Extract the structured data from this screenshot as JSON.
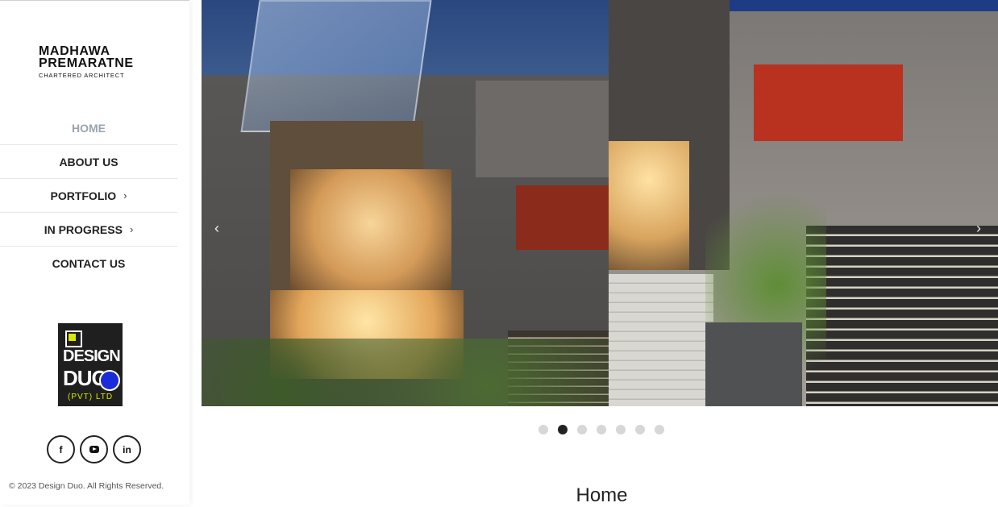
{
  "brand": {
    "line1": "MADHAWA",
    "line2": "PREMARATNE",
    "line3": "CHARTERED ARCHITECT"
  },
  "nav": {
    "items": [
      {
        "label": "HOME",
        "active": true,
        "has_chevron": false
      },
      {
        "label": "ABOUT US",
        "active": false,
        "has_chevron": false
      },
      {
        "label": "PORTFOLIO",
        "active": false,
        "has_chevron": true
      },
      {
        "label": "IN PROGRESS",
        "active": false,
        "has_chevron": true
      },
      {
        "label": "CONTACT US",
        "active": false,
        "has_chevron": false
      }
    ],
    "chevron": "›"
  },
  "badge": {
    "line1": "DESIGN",
    "line2": "DUO",
    "line3": "(PVT) LTD"
  },
  "social": {
    "facebook_label": "f",
    "linkedin_label": "in",
    "icons": [
      "facebook-icon",
      "youtube-icon",
      "linkedin-icon"
    ]
  },
  "footer": {
    "copyright": "© 2023 Design Duo. All Rights Reserved."
  },
  "slider": {
    "prev_glyph": "‹",
    "next_glyph": "›",
    "dots_total": 7,
    "active_dot_index": 1
  },
  "main": {
    "title": "Home"
  },
  "colors": {
    "accent_lime": "#d9e800",
    "badge_blue": "#1c2bd9",
    "nav_active": "#9aa3ad"
  }
}
